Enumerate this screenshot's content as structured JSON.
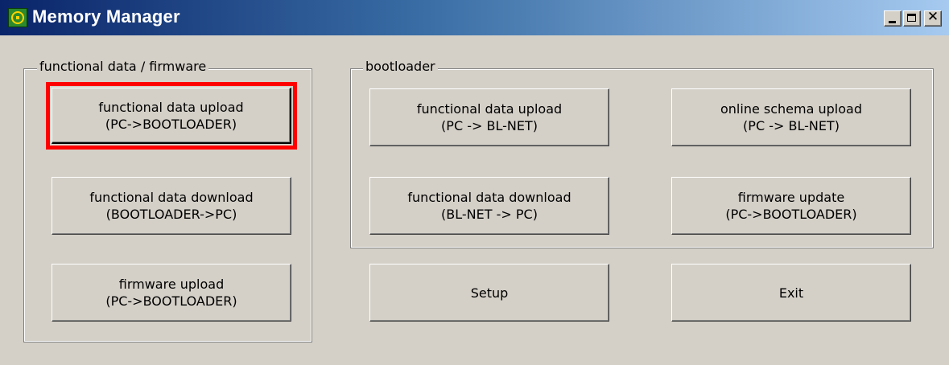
{
  "window": {
    "title": "Memory Manager",
    "controls": {
      "minimize": "minimize",
      "maximize": "maximize",
      "close": "✕"
    }
  },
  "groups": {
    "firmware": {
      "label": "functional data / firmware",
      "buttons": [
        {
          "line1": "functional data upload",
          "line2": "(PC->BOOTLOADER)",
          "highlighted": true
        },
        {
          "line1": "functional data download",
          "line2": "(BOOTLOADER->PC)"
        },
        {
          "line1": "firmware upload",
          "line2": "(PC->BOOTLOADER)"
        }
      ]
    },
    "bootloader": {
      "label": "bootloader",
      "buttons": [
        {
          "line1": "functional data upload",
          "line2": "(PC -> BL-NET)"
        },
        {
          "line1": "online schema upload",
          "line2": "(PC -> BL-NET)"
        },
        {
          "line1": "functional data download",
          "line2": "(BL-NET -> PC)"
        },
        {
          "line1": "firmware update",
          "line2": "(PC->BOOTLOADER)"
        }
      ]
    }
  },
  "actions": {
    "setup_label": "Setup",
    "exit_label": "Exit"
  },
  "colors": {
    "highlight": "#ff0000",
    "titlebar_start": "#0a246a",
    "titlebar_end": "#a6caf0",
    "face": "#d4d0c8"
  }
}
